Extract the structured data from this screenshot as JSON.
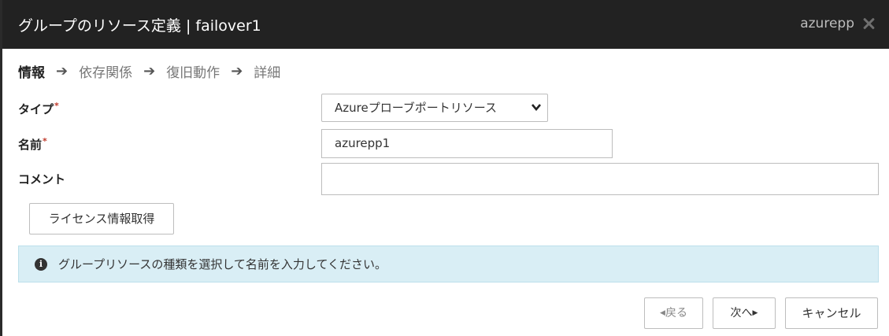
{
  "dialog": {
    "title": "グループのリソース定義",
    "title_separator": "|",
    "title_group": "failover1",
    "user": "azurepp",
    "close_icon": "close-icon"
  },
  "steps": [
    {
      "label": "情報",
      "active": true
    },
    {
      "label": "依存関係",
      "active": false
    },
    {
      "label": "復旧動作",
      "active": false
    },
    {
      "label": "詳細",
      "active": false
    }
  ],
  "step_arrow": "➔",
  "form": {
    "type_label": "タイプ",
    "type_value": "Azureプローブポートリソース",
    "name_label": "名前",
    "name_value": "azurepp1",
    "comment_label": "コメント",
    "comment_value": "",
    "required_mark": "*"
  },
  "license_button": "ライセンス情報取得",
  "alert": {
    "icon": "info-icon",
    "message": "グループリソースの種類を選択して名前を入力してください。"
  },
  "footer": {
    "back_label": "戻る",
    "next_label": "次へ",
    "cancel_label": "キャンセル"
  },
  "colors": {
    "titlebar": "#222222",
    "alert_bg": "#d9eef5",
    "required": "#c0392b"
  }
}
